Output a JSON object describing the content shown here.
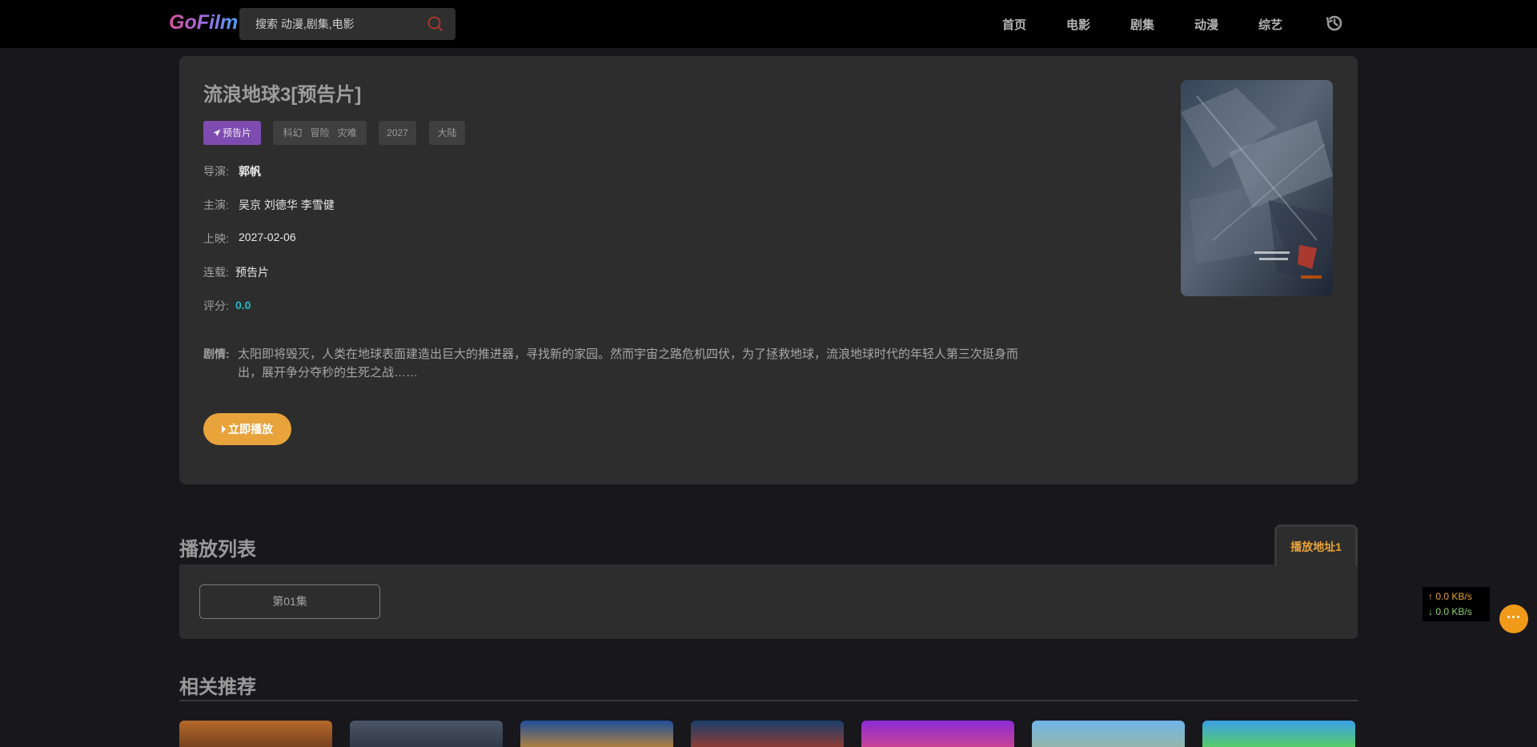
{
  "header": {
    "logo": "GoFilm",
    "search_placeholder": "搜索 动漫,剧集,电影",
    "nav": [
      "首页",
      "电影",
      "剧集",
      "动漫",
      "综艺"
    ]
  },
  "detail": {
    "title": "流浪地球3[预告片]",
    "tags": {
      "trailer": "预告片",
      "genres": [
        "科幻",
        "冒险",
        "灾难"
      ],
      "year": "2027",
      "region": "大陆"
    },
    "director_label": "导演:",
    "director": "郭帆",
    "cast_label": "主演:",
    "cast": "吴京 刘德华 李雪健",
    "release_label": "上映:",
    "release": "2027-02-06",
    "status_label": "连载:",
    "status": "预告片",
    "score_label": "评分:",
    "score": "0.0",
    "plot_label": "剧情:",
    "plot": "太阳即将毁灭，人类在地球表面建造出巨大的推进器，寻找新的家园。然而宇宙之路危机四伏，为了拯救地球，流浪地球时代的年轻人第三次挺身而出，展开争分夺秒的生死之战……",
    "play_button": "立即播放"
  },
  "playlist": {
    "title": "播放列表",
    "source_tab": "播放地址1",
    "episodes": [
      "第01集"
    ]
  },
  "recommend": {
    "title": "相关推荐"
  },
  "net_widget": {
    "up": "↑ 0.0 KB/s",
    "down": "↓ 0.0 KB/s"
  },
  "fab_label": "···",
  "colors": {
    "accent_orange": "#e8a33b",
    "trailer_purple": "#7e4cb0",
    "score_cyan": "#1fb9c7",
    "card_bg": "#2d2d2d",
    "page_bg": "#18171c"
  },
  "icons": [
    "search-icon",
    "history-icon",
    "send-icon",
    "play-icon"
  ]
}
